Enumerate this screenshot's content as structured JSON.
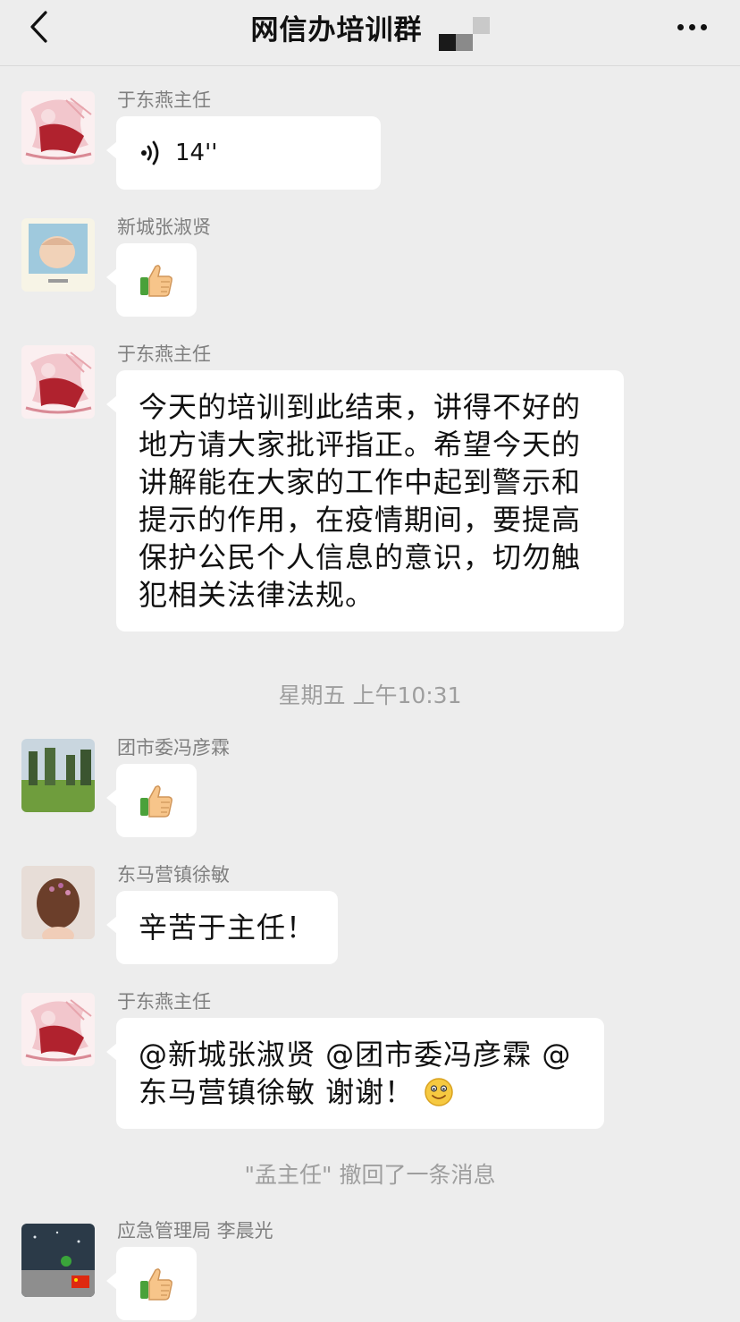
{
  "header": {
    "title": "网信办培训群",
    "back_icon": "chevron-left-icon",
    "more_icon": "more-dots-icon"
  },
  "messages": [
    {
      "sender": "于东燕主任",
      "type": "voice",
      "duration": "14''"
    },
    {
      "sender": "新城张淑贤",
      "type": "emoji",
      "emoji": "thumbs-up-icon"
    },
    {
      "sender": "于东燕主任",
      "type": "text",
      "lines": [
        "今天的培训到此结束，讲得不好的",
        "地方请大家批评指正。希望今天的",
        "讲解能在大家的工作中起到警示和",
        "提示的作用，在疫情期间，要提高",
        "保护公民个人信息的意识，切勿触",
        "犯相关法律法规。"
      ]
    },
    {
      "sender": "团市委冯彦霖",
      "type": "emoji",
      "emoji": "thumbs-up-icon"
    },
    {
      "sender": "东马营镇徐敏",
      "type": "text",
      "lines": [
        "辛苦于主任！"
      ]
    },
    {
      "sender": "于东燕主任",
      "type": "text",
      "lines": [
        "@新城张淑贤 @团市委冯彦霖 @",
        "东马营镇徐敏 谢谢！"
      ],
      "trailing_emoji": "smile-emoji-icon"
    },
    {
      "sender": "应急管理局 李晨光",
      "type": "emoji",
      "emoji": "thumbs-up-icon"
    }
  ],
  "timestamp": "星期五 上午10:31",
  "system_note": "\"孟主任\" 撤回了一条消息",
  "colors": {
    "background": "#ededed",
    "bubble": "#ffffff",
    "meta_text": "#9e9e9e",
    "sender_text": "#7f7f7f"
  }
}
